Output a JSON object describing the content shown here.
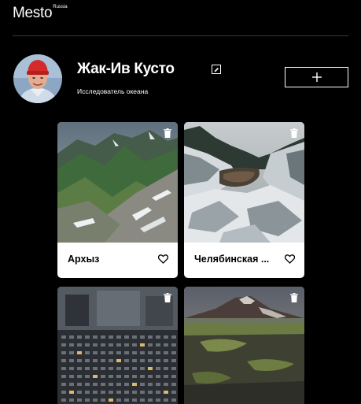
{
  "header": {
    "logo_text": "Mesto",
    "logo_sup": "Russia"
  },
  "profile": {
    "name": "Жак-Ив Кусто",
    "about": "Исследователь океана",
    "edit_icon": "pencil-icon",
    "add_icon": "plus-icon"
  },
  "cards": [
    {
      "title": "Архыз"
    },
    {
      "title": "Челябинская ..."
    },
    {
      "title": ""
    },
    {
      "title": ""
    }
  ],
  "icons": {
    "trash": "trash-icon",
    "like": "heart-icon"
  }
}
